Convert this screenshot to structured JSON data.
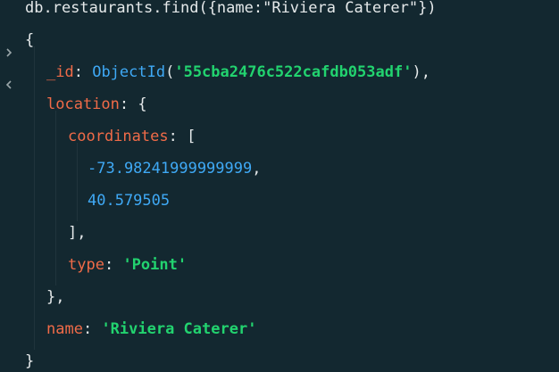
{
  "command": "db.restaurants.find({name:\"Riviera Caterer\"})",
  "result": {
    "open_brace": "{",
    "id_key": "_id",
    "id_fn": "ObjectId",
    "id_value": "'55cba2476c522cafdb053adf'",
    "location_key": "location",
    "coordinates_key": "coordinates",
    "coord_1": "-73.98241999999999",
    "coord_2": "40.579505",
    "type_key": "type",
    "type_value": "'Point'",
    "name_key": "name",
    "name_value": "'Riviera Caterer'",
    "close_brace": "}"
  },
  "colors": {
    "background": "#132830",
    "key": "#f06b48",
    "string": "#22d36f",
    "number": "#3fa9f5",
    "text": "#e5e9ea"
  },
  "icons": [
    "prompt-chevron-right-icon",
    "result-chevron-left-icon"
  ]
}
